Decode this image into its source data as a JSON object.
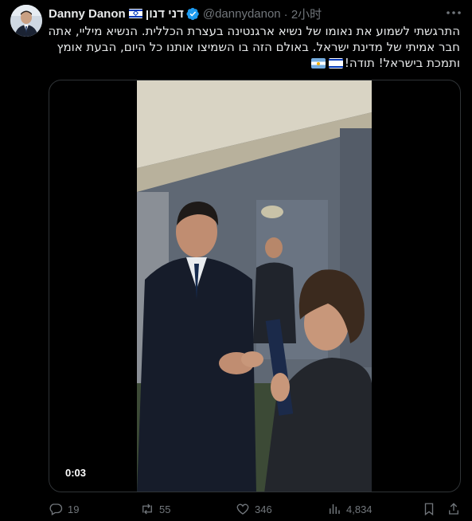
{
  "author": {
    "display_name": "Danny Danon",
    "hebrew_name": "דני דנון",
    "handle": "@dannydanon",
    "time": "· 2小时",
    "verified": true,
    "flag_icon": "israel-flag-icon"
  },
  "tweet": {
    "text_lines": [
      "התרגשתי לשמוע את נאומו של נשיא ארגנטינה בעצרת הכללית. הנשיא מיליי, אתה",
      "חבר אמיתי של מדינת ישראל. באולם הזה בו השמיצו אותנו כל היום, הבעת אומץ",
      "ותמכת בישראל! תודה!"
    ],
    "trailing_emojis": [
      "israel-flag-emoji",
      "argentina-flag-emoji"
    ]
  },
  "video": {
    "timestamp": "0:03"
  },
  "actions": {
    "replies": "19",
    "retweets": "55",
    "likes": "346",
    "views": "4,834"
  },
  "colors": {
    "background": "#000000",
    "text": "#e7e9ea",
    "muted": "#71767b",
    "verified": "#1d9bf0",
    "border": "#2f3336"
  }
}
